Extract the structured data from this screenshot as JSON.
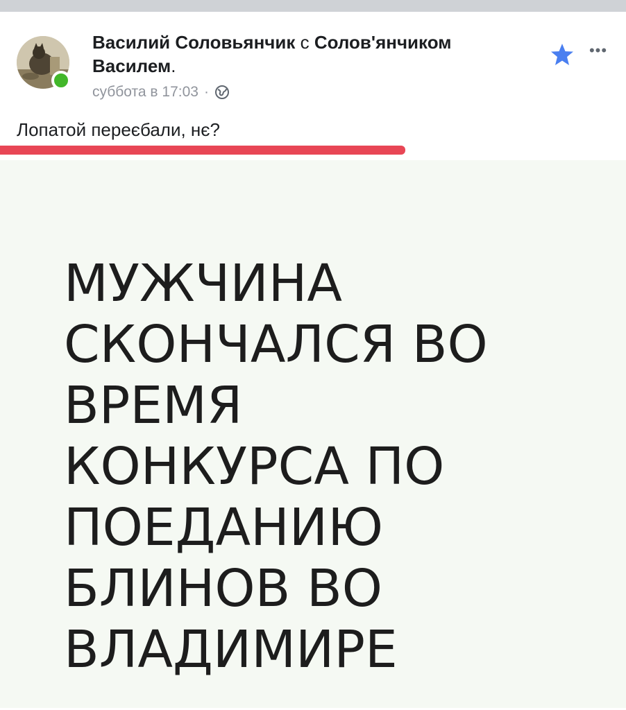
{
  "post": {
    "author": {
      "name": "Василий Соловьянчик",
      "connector": " с ",
      "tagged": "Солов'янчиком Василем",
      "period": "."
    },
    "meta": {
      "time": "суббота в 17:03",
      "separator": "·",
      "privacy_icon": "globe-icon"
    },
    "actions": {
      "star_icon": "star-icon",
      "more_label": "•••"
    },
    "text": "Лопатой переєбали, нє?",
    "accent_color": "#e84655",
    "image": {
      "lines": [
        "МУЖЧИНА",
        "СКОНЧАЛСЯ ВО",
        "ВРЕМЯ",
        "КОНКУРСА ПО",
        "ПОЕДАНИЮ",
        "БЛИНОВ ВО",
        "ВЛАДИМИРЕ"
      ]
    }
  }
}
